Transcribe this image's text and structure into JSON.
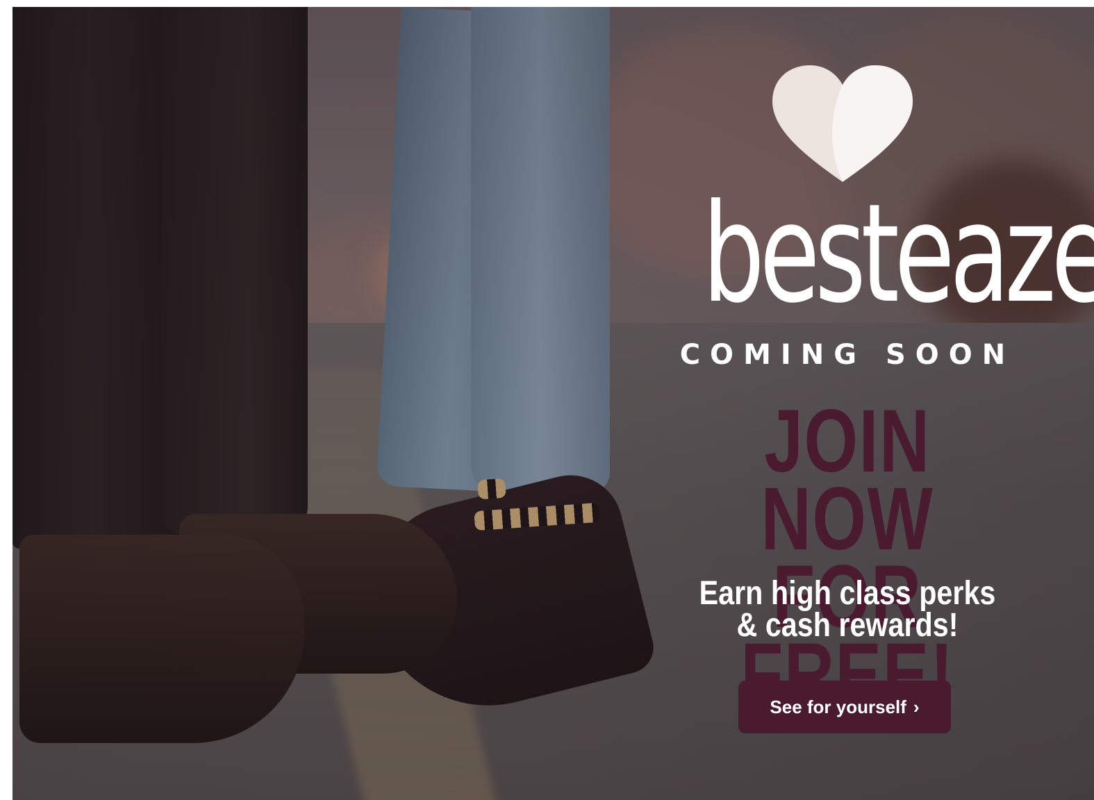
{
  "brand": {
    "name": "besteaze",
    "tagline": "COMING SOON"
  },
  "headline": {
    "line1": "JOIN NOW",
    "line2": "FOR FREE!"
  },
  "subhead": {
    "line1": "Earn high class perks",
    "line2": "& cash rewards!"
  },
  "cta": {
    "label": "See for yourself",
    "icon": "chevron-right-icon"
  },
  "colors": {
    "accent": "#4a1a2e",
    "text": "#ffffff",
    "logo_heart": "#f4ece8"
  },
  "background_image": "photo-icon"
}
